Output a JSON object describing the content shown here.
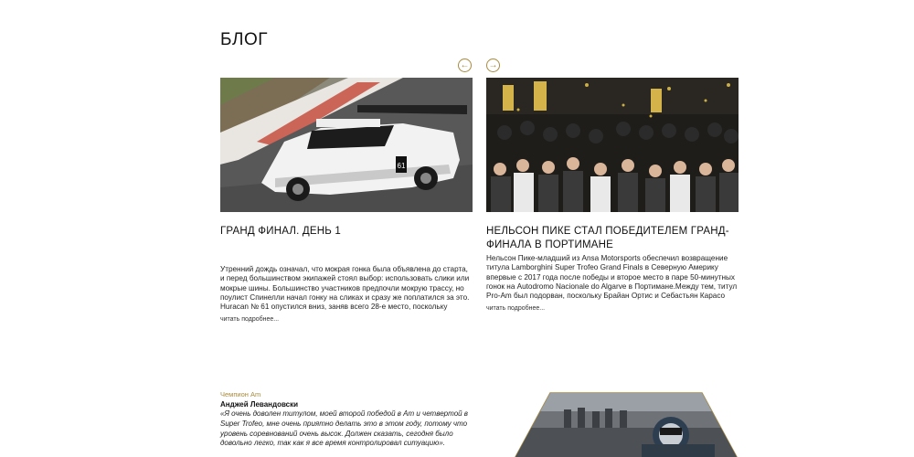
{
  "blog": {
    "title": "БЛОГ",
    "prev_label": "←",
    "next_label": "→"
  },
  "posts": [
    {
      "title": "ГРАНД ФИНАЛ. ДЕНЬ 1",
      "excerpt": "Утренний дождь означал, что мокрая гонка была объявлена до старта, и перед большинством экипажей стоял выбор: использовать слики или мокрые шины. Большинство участников предпочли мокрую трассу, но поулист Спинелли начал гонку на сликах и сразу же поплатился за это. Huracan № 61 опустился вниз, заняв всего 28-е место, поскольку",
      "read_more": "читать подробнее...",
      "image_icon": "race-car-photo"
    },
    {
      "title": "НЕЛЬСОН ПИКЕ СТАЛ ПОБЕДИТЕЛЕМ ГРАНД-ФИНАЛА В ПОРТИМАНЕ",
      "excerpt": "Нельсон Пике-младший из Ansa Motorsports обеспечил возвращение титула Lamborghini Super Trofeo Grand Finals в Северную Америку впервые с 2017 года после победы и второе место в паре 50-минутных гонок на Autodromo Nacionale do Algarve в Портимане.Между тем, титул Pro-Am был подорван, поскольку Брайан Ортис и Себастьян Карасо",
      "read_more": "читать подробнее...",
      "image_icon": "podium-celebration-photo"
    }
  ],
  "champion": {
    "label": "Чемпион Am",
    "name": "Анджей Левандовски",
    "quote": "«Я очень доволен титулом, моей второй победой в Am и четвертой в Super Trofeo, мне очень приятно делать это в этом году, потому что уровень соревнований очень высок. Должен сказать, сегодня было довольно легко, так как я все время контролировал ситуацию»."
  },
  "colors": {
    "accent": "#a88a3e",
    "text": "#111111"
  }
}
